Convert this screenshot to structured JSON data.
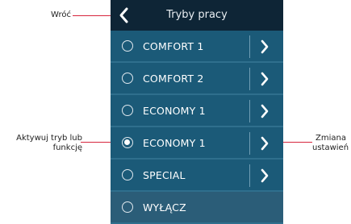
{
  "header": {
    "title": "Tryby pracy",
    "back_icon": "chevron-left-icon"
  },
  "modes": [
    {
      "label": "COMFORT 1",
      "selected": false,
      "has_settings": true
    },
    {
      "label": "COMFORT 2",
      "selected": false,
      "has_settings": true
    },
    {
      "label": "ECONOMY 1",
      "selected": false,
      "has_settings": true
    },
    {
      "label": "ECONOMY 1",
      "selected": true,
      "has_settings": true
    },
    {
      "label": "SPECIAL",
      "selected": false,
      "has_settings": true
    },
    {
      "label": "WYŁĄCZ",
      "selected": false,
      "has_settings": false
    }
  ],
  "callouts": {
    "back": "Wróć",
    "activate_line1": "Aktywuj tryb lub",
    "activate_line2": "funkcję",
    "settings_line1": "Zmiana",
    "settings_line2": "ustawień"
  },
  "colors": {
    "header_bg": "#0e2536",
    "row_bg": "#1b5a78",
    "row_separator": "#2f6f8d",
    "leader_line": "#d7263d"
  }
}
